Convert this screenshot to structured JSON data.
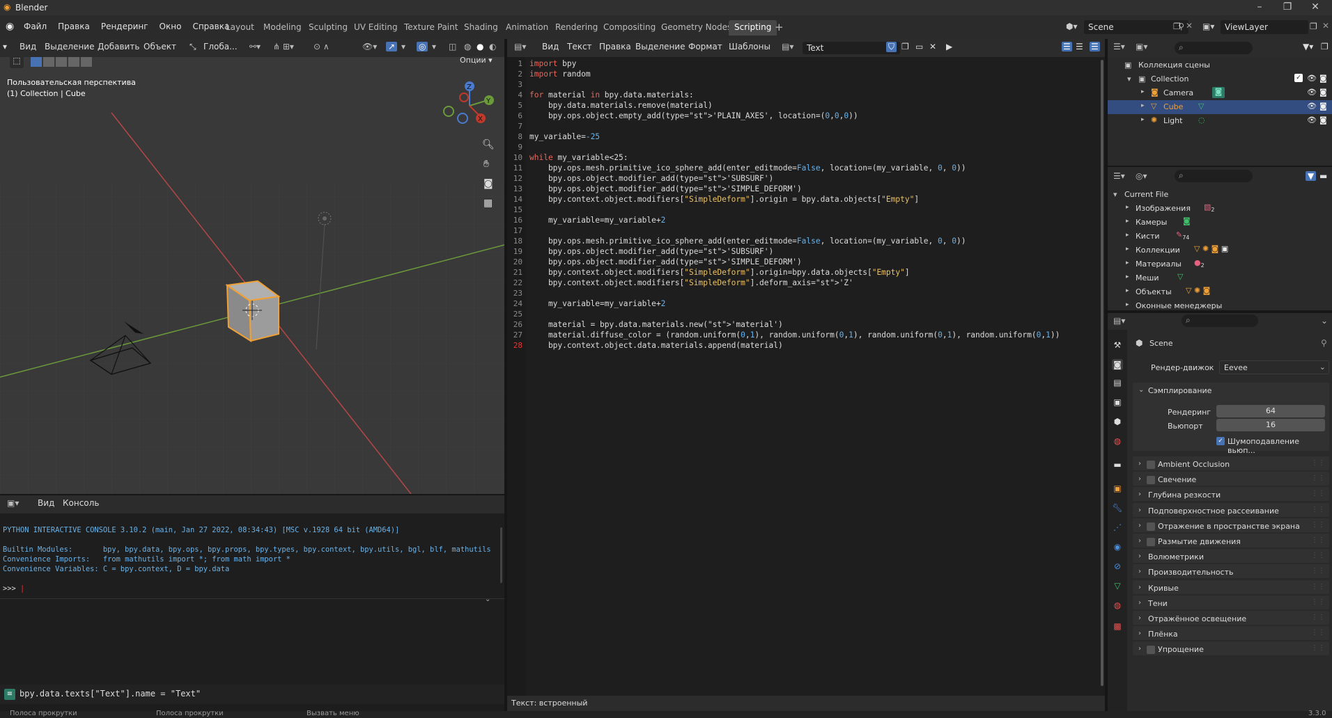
{
  "app": {
    "title": "Blender"
  },
  "menu": {
    "items": [
      "Файл",
      "Правка",
      "Рендеринг",
      "Окно",
      "Справка"
    ]
  },
  "workspaces": {
    "tabs": [
      "Layout",
      "Modeling",
      "Sculpting",
      "UV Editing",
      "Texture Paint",
      "Shading",
      "Animation",
      "Rendering",
      "Compositing",
      "Geometry Nodes",
      "Scripting"
    ],
    "active": "Scripting"
  },
  "scene": {
    "name": "Scene",
    "view_layer": "ViewLayer"
  },
  "viewport": {
    "menu": [
      "Вид",
      "Выделение",
      "Добавить",
      "Объект"
    ],
    "orientation": "Глоба...",
    "options_label": "Опции",
    "perspective_label": "Пользовательская перспектива",
    "collection_label": "(1) Collection | Cube",
    "gizmo_axes": [
      "X",
      "Y",
      "Z"
    ]
  },
  "text_editor": {
    "menu": [
      "Вид",
      "Текст",
      "Правка",
      "Выделение",
      "Формат",
      "Шаблоны"
    ],
    "text_name": "Text",
    "footer": "Текст: встроенный",
    "lines": [
      "import bpy",
      "import random",
      "",
      "for material in bpy.data.materials:",
      "    bpy.data.materials.remove(material)",
      "    bpy.ops.object.empty_add(type='PLAIN_AXES', location=(0,0,0))",
      "",
      "my_variable=-25",
      "",
      "while my_variable<25:",
      "    bpy.ops.mesh.primitive_ico_sphere_add(enter_editmode=False, location=(my_variable, 0, 0))",
      "    bpy.ops.object.modifier_add(type='SUBSURF')",
      "    bpy.ops.object.modifier_add(type='SIMPLE_DEFORM')",
      "    bpy.context.object.modifiers[\"SimpleDeform\"].origin = bpy.data.objects[\"Empty\"]",
      "",
      "    my_variable=my_variable+2",
      "",
      "    bpy.ops.mesh.primitive_ico_sphere_add(enter_editmode=False, location=(my_variable, 0, 0))",
      "    bpy.ops.object.modifier_add(type='SUBSURF')",
      "    bpy.ops.object.modifier_add(type='SIMPLE_DEFORM')",
      "    bpy.context.object.modifiers[\"SimpleDeform\"].origin=bpy.data.objects[\"Empty\"]",
      "    bpy.context.object.modifiers[\"SimpleDeform\"].deform_axis='Z'",
      "",
      "    my_variable=my_variable+2",
      "",
      "    material = bpy.data.materials.new('material')",
      "    material.diffuse_color = (random.uniform(0,1), random.uniform(0,1), random.uniform(0,1), random.uniform(0,1))",
      "    bpy.context.object.data.materials.append(material)"
    ]
  },
  "console": {
    "menu": [
      "Вид",
      "Консоль"
    ],
    "line1": "PYTHON INTERACTIVE CONSOLE 3.10.2 (main, Jan 27 2022, 08:34:43) [MSC v.1928 64 bit (AMD64)]",
    "line2": "Builtin Modules:       bpy, bpy.data, bpy.ops, bpy.props, bpy.types, bpy.context, bpy.utils, bgl, blf, mathutils",
    "line3": "Convenience Imports:   from mathutils import *; from math import *",
    "line4": "Convenience Variables: C = bpy.context, D = bpy.data",
    "prompt": ">>> ",
    "info": "bpy.data.texts[\"Text\"].name = \"Text\""
  },
  "statusbar": {
    "items": [
      "Полоса прокрутки",
      "Полоса прокрутки",
      "Вызвать меню"
    ],
    "version": "3.3.0"
  },
  "outliner": {
    "scene_collection": "Коллекция сцены",
    "collection": "Collection",
    "objects": [
      "Camera",
      "Cube",
      "Light"
    ],
    "selected": "Cube"
  },
  "file_browser": {
    "root": "Current File",
    "items": [
      "Изображения",
      "Камеры",
      "Кисти",
      "Коллекции",
      "Материалы",
      "Меши",
      "Объекты",
      "Оконные менеджеры"
    ],
    "badges": {
      "images": "2",
      "brushes": "74",
      "materials": "2"
    }
  },
  "properties": {
    "scene_name": "Scene",
    "render_engine_label": "Рендер-движок",
    "render_engine": "Eevee",
    "sampling": {
      "title": "Сэмплирование",
      "render_label": "Рендеринг",
      "render_value": "64",
      "viewport_label": "Вьюпорт",
      "viewport_value": "16",
      "denoise_label": "Шумоподавление вьюп..."
    },
    "panels": [
      {
        "label": "Ambient Occlusion",
        "checkbox": true
      },
      {
        "label": "Свечение",
        "checkbox": true
      },
      {
        "label": "Глубина резкости",
        "checkbox": false
      },
      {
        "label": "Подповерхностное рассеивание",
        "checkbox": false
      },
      {
        "label": "Отражение в пространстве экрана",
        "checkbox": true
      },
      {
        "label": "Размытие движения",
        "checkbox": true
      },
      {
        "label": "Волюметрики",
        "checkbox": false
      },
      {
        "label": "Производительность",
        "checkbox": false
      },
      {
        "label": "Кривые",
        "checkbox": false
      },
      {
        "label": "Тени",
        "checkbox": false
      },
      {
        "label": "Отражённое освещение",
        "checkbox": false
      },
      {
        "label": "Плёнка",
        "checkbox": false
      },
      {
        "label": "Упрощение",
        "checkbox": true
      }
    ]
  },
  "colors": {
    "accent": "#4772b3",
    "selection": "#334d80",
    "orange": "#f0a035"
  }
}
